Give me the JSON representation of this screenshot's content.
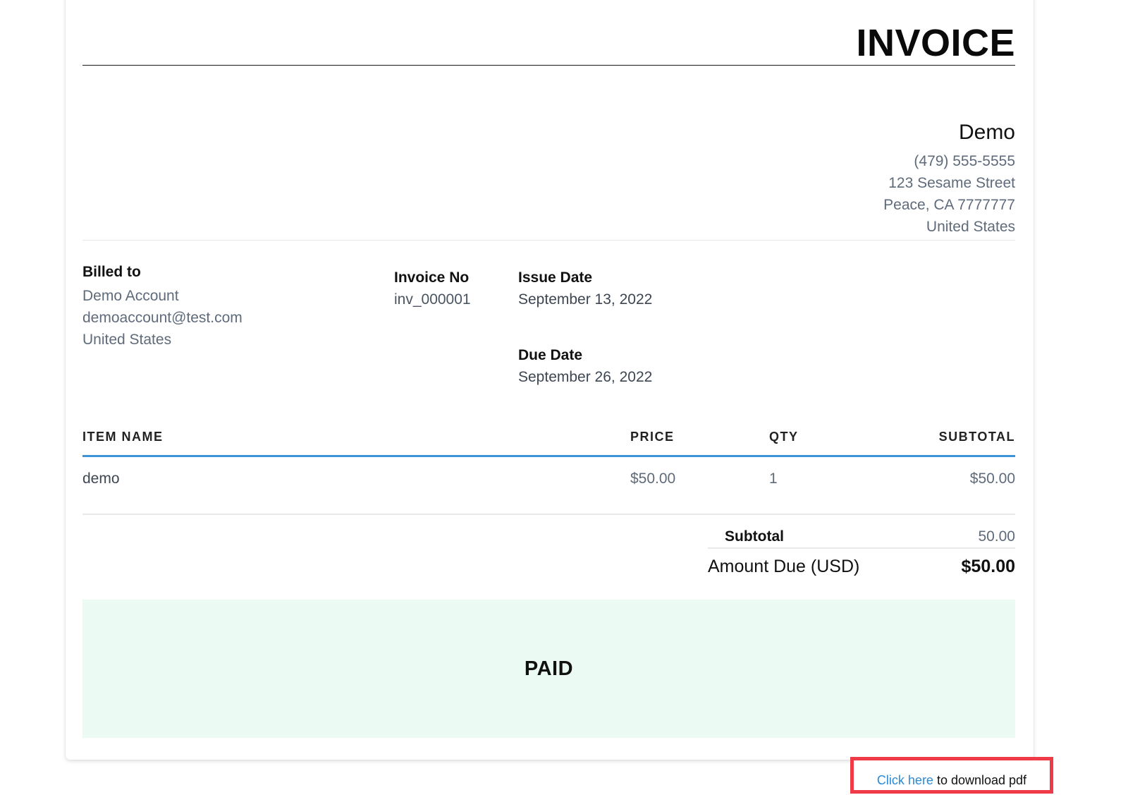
{
  "invoice": {
    "title": "INVOICE",
    "company": {
      "name": "Demo",
      "phone": "(479) 555-5555",
      "street": "123 Sesame Street",
      "city": "Peace, CA 7777777",
      "country": "United States"
    },
    "billed_to": {
      "label": "Billed to",
      "name": "Demo Account",
      "email": "demoaccount@test.com",
      "country": "United States"
    },
    "invoice_no": {
      "label": "Invoice No",
      "value": "inv_000001"
    },
    "issue_date": {
      "label": "Issue Date",
      "value": "September 13, 2022"
    },
    "due_date": {
      "label": "Due Date",
      "value": "September 26, 2022"
    },
    "table": {
      "headers": {
        "item": "ITEM NAME",
        "price": "PRICE",
        "qty": "QTY",
        "subtotal": "SUBTOTAL"
      },
      "rows": [
        {
          "item": "demo",
          "price": "$50.00",
          "qty": "1",
          "subtotal": "$50.00"
        }
      ]
    },
    "totals": {
      "subtotal_label": "Subtotal",
      "subtotal_value": "50.00",
      "amount_due_label": "Amount Due (USD)",
      "amount_due_value": "$50.00"
    },
    "status": "PAID"
  },
  "download": {
    "link_text": "Click here",
    "rest_text": " to download pdf"
  },
  "colors": {
    "accent_blue": "#3b93d8",
    "link_blue": "#2b8ad6",
    "paid_background": "#ebfbf3",
    "highlight_red": "#ef3a47",
    "muted_text": "#5f6b7a"
  }
}
